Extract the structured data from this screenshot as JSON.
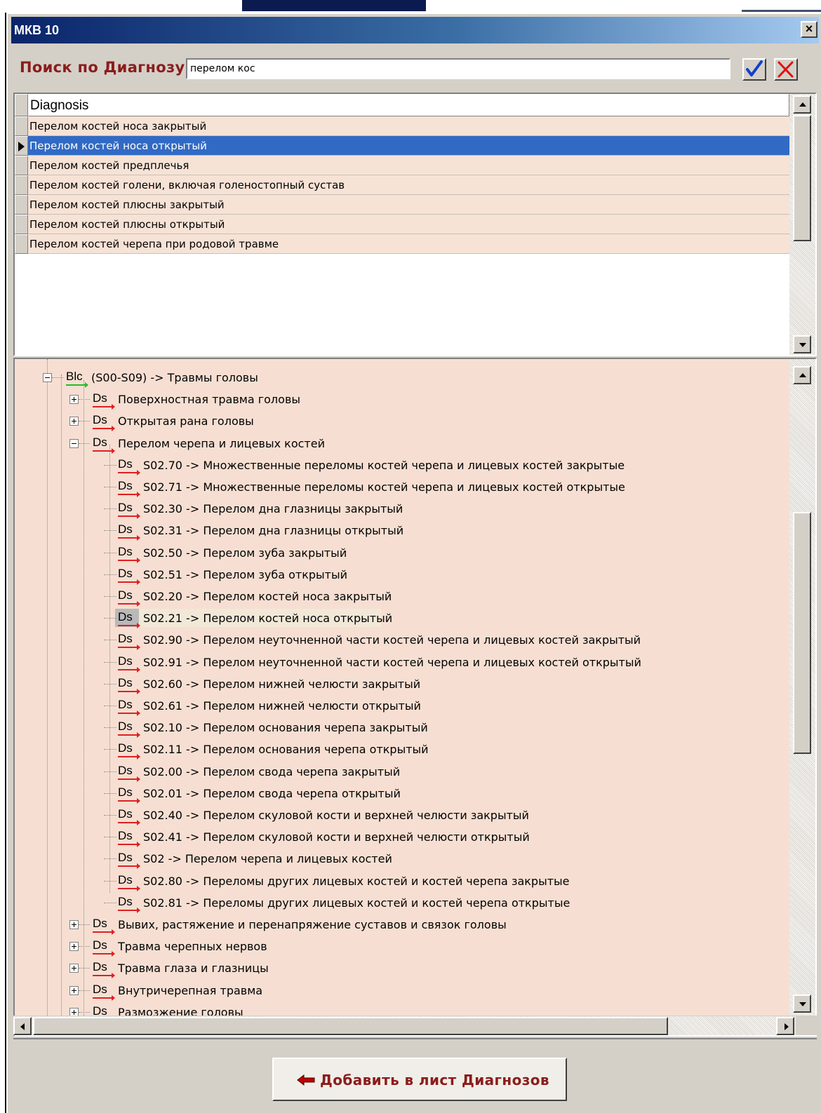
{
  "window": {
    "title": "МКВ 10",
    "close_label": "×"
  },
  "search": {
    "label": "Поиск по  Диагнозу",
    "value": "перелом кос"
  },
  "grid": {
    "column": "Diagnosis",
    "selected_index": 1,
    "rows": [
      "Перелом костей носа закрытый",
      "Перелом костей носа открытый",
      "Перелом костей предплечья",
      "Перелом костей голени, включая голеностопный сустав",
      "Перелом костей плюсны закрытый",
      "Перелом костей плюсны открытый",
      "Перелом костей черепа при родовой травме"
    ]
  },
  "tree": {
    "block": {
      "tag": "Blc",
      "label": "(S00-S09) -> Травмы головы"
    },
    "groups_before": [
      {
        "tag": "Ds",
        "label": "Поверхностная травма головы"
      },
      {
        "tag": "Ds",
        "label": "Открытая рана головы"
      }
    ],
    "expanded_group": {
      "tag": "Ds",
      "label": "Перелом черепа и лицевых костей"
    },
    "highlighted_child_index": 7,
    "children": [
      {
        "tag": "Ds",
        "label": "S02.70 -> Множественные переломы костей черепа и лицевых костей закрытые"
      },
      {
        "tag": "Ds",
        "label": "S02.71 -> Множественные переломы костей черепа и лицевых костей открытые"
      },
      {
        "tag": "Ds",
        "label": "S02.30 -> Перелом дна глазницы закрытый"
      },
      {
        "tag": "Ds",
        "label": "S02.31 -> Перелом дна глазницы открытый"
      },
      {
        "tag": "Ds",
        "label": "S02.50 -> Перелом зуба закрытый"
      },
      {
        "tag": "Ds",
        "label": "S02.51 -> Перелом зуба открытый"
      },
      {
        "tag": "Ds",
        "label": "S02.20 -> Перелом костей носа закрытый"
      },
      {
        "tag": "Ds",
        "label": "S02.21 -> Перелом костей носа открытый"
      },
      {
        "tag": "Ds",
        "label": "S02.90 -> Перелом неуточненной части костей черепа и лицевых костей закрытый"
      },
      {
        "tag": "Ds",
        "label": "S02.91 -> Перелом неуточненной части костей черепа и лицевых костей открытый"
      },
      {
        "tag": "Ds",
        "label": "S02.60 -> Перелом нижней челюсти закрытый"
      },
      {
        "tag": "Ds",
        "label": "S02.61 -> Перелом нижней челюсти открытый"
      },
      {
        "tag": "Ds",
        "label": "S02.10 -> Перелом основания черепа закрытый"
      },
      {
        "tag": "Ds",
        "label": "S02.11 -> Перелом основания черепа открытый"
      },
      {
        "tag": "Ds",
        "label": "S02.00 -> Перелом свода черепа закрытый"
      },
      {
        "tag": "Ds",
        "label": "S02.01 -> Перелом свода черепа открытый"
      },
      {
        "tag": "Ds",
        "label": "S02.40 -> Перелом скуловой кости и верхней челюсти закрытый"
      },
      {
        "tag": "Ds",
        "label": "S02.41 -> Перелом скуловой кости и верхней челюсти открытый"
      },
      {
        "tag": "Ds",
        "label": "S02 -> Перелом черепа и лицевых костей"
      },
      {
        "tag": "Ds",
        "label": "S02.80 -> Переломы других лицевых костей и костей черепа закрытые"
      },
      {
        "tag": "Ds",
        "label": "S02.81 -> Переломы других лицевых костей и костей черепа открытые"
      }
    ],
    "groups_after": [
      {
        "tag": "Ds",
        "label": "Вывих, растяжение и перенапряжение суставов и связок головы"
      },
      {
        "tag": "Ds",
        "label": "Травма черепных нервов"
      },
      {
        "tag": "Ds",
        "label": "Травма глаза и глазницы"
      },
      {
        "tag": "Ds",
        "label": "Внутричерепная травма"
      },
      {
        "tag": "Ds",
        "label": "Размозжение головы"
      }
    ]
  },
  "add_button": {
    "label": "Добавить в лист Диагнозов",
    "icon": "arrow-left-icon"
  },
  "icons": {
    "ok": "check-icon",
    "cancel": "cross-icon"
  },
  "colors": {
    "accent_label": "#8b1c1c",
    "selection": "#316ac5",
    "tree_bg": "#f6dfd2"
  }
}
